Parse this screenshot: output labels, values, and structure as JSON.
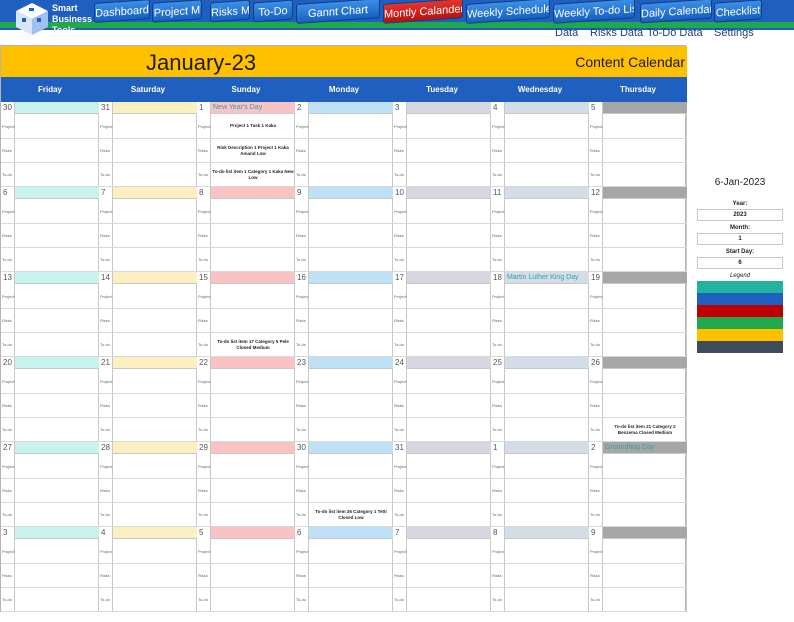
{
  "brand": {
    "line1": "Smart",
    "line2": "Business",
    "line3": "Tools"
  },
  "nav": {
    "tabs": [
      {
        "label": "Dashboard",
        "active": false
      },
      {
        "label": "Project M",
        "active": false
      },
      {
        "label": "Risks M.",
        "active": false
      },
      {
        "label": "To-Do",
        "active": false
      },
      {
        "label": "Gannt Chart",
        "active": false
      },
      {
        "label": "Montly Calander",
        "active": true
      },
      {
        "label": "Weekly Schedule",
        "active": false
      },
      {
        "label": "Weekly To-do List",
        "active": false
      },
      {
        "label": "Daily Calendar",
        "active": false
      },
      {
        "label": "Checklist",
        "active": false
      }
    ],
    "sublinks": [
      "Data",
      "Risks Data",
      "To-Do Data",
      "Settings"
    ]
  },
  "calendar": {
    "month_title": "January-23",
    "subtitle": "Content Calendar",
    "days": [
      "Friday",
      "Saturday",
      "Sunday",
      "Monday",
      "Tuesday",
      "Wednesday",
      "Thursday"
    ],
    "row_labels": [
      "Project",
      "Risks",
      "To-do"
    ],
    "day_colors": [
      "#c8f2ee",
      "#fcefc2",
      "#f9c3c3",
      "#bfe1f7",
      "#d6d6e0",
      "#d2dde8",
      "#a6a6a6"
    ],
    "weeks": [
      [
        {
          "date": "30",
          "holiday": "",
          "items": [
            "",
            "",
            ""
          ]
        },
        {
          "date": "31",
          "holiday": "",
          "items": [
            "",
            "",
            ""
          ]
        },
        {
          "date": "1",
          "holiday": "New Year's Day",
          "items": [
            "Project 1 Task 1 Kaka",
            "Risk Description 1 Project 1 Kaka Amand Low",
            "To-do list item 1 Category 1 Kaka New Low"
          ]
        },
        {
          "date": "2",
          "holiday": "",
          "items": [
            "",
            "",
            ""
          ]
        },
        {
          "date": "3",
          "holiday": "",
          "items": [
            "",
            "",
            ""
          ]
        },
        {
          "date": "4",
          "holiday": "",
          "items": [
            "",
            "",
            ""
          ]
        },
        {
          "date": "5",
          "holiday": "",
          "items": [
            "",
            "",
            ""
          ]
        }
      ],
      [
        {
          "date": "6",
          "holiday": "",
          "items": [
            "",
            "",
            ""
          ]
        },
        {
          "date": "7",
          "holiday": "",
          "items": [
            "",
            "",
            ""
          ]
        },
        {
          "date": "8",
          "holiday": "",
          "items": [
            "",
            "",
            ""
          ]
        },
        {
          "date": "9",
          "holiday": "",
          "items": [
            "",
            "",
            ""
          ]
        },
        {
          "date": "10",
          "holiday": "",
          "items": [
            "",
            "",
            ""
          ]
        },
        {
          "date": "11",
          "holiday": "",
          "items": [
            "",
            "",
            ""
          ]
        },
        {
          "date": "12",
          "holiday": "",
          "items": [
            "",
            "",
            ""
          ]
        }
      ],
      [
        {
          "date": "13",
          "holiday": "",
          "items": [
            "",
            "",
            ""
          ]
        },
        {
          "date": "14",
          "holiday": "",
          "items": [
            "",
            "",
            ""
          ]
        },
        {
          "date": "15",
          "holiday": "",
          "items": [
            "",
            "",
            "To-do list item 17 Category 5 Pele Closed Medium"
          ]
        },
        {
          "date": "16",
          "holiday": "",
          "items": [
            "",
            "",
            ""
          ]
        },
        {
          "date": "17",
          "holiday": "",
          "items": [
            "",
            "",
            ""
          ]
        },
        {
          "date": "18",
          "holiday": "Martin Luther King Day",
          "items": [
            "",
            "",
            ""
          ]
        },
        {
          "date": "19",
          "holiday": "",
          "items": [
            "",
            "",
            ""
          ]
        }
      ],
      [
        {
          "date": "20",
          "holiday": "",
          "items": [
            "",
            "",
            ""
          ]
        },
        {
          "date": "21",
          "holiday": "",
          "items": [
            "",
            "",
            ""
          ]
        },
        {
          "date": "22",
          "holiday": "",
          "items": [
            "",
            "",
            ""
          ]
        },
        {
          "date": "23",
          "holiday": "",
          "items": [
            "",
            "",
            ""
          ]
        },
        {
          "date": "24",
          "holiday": "",
          "items": [
            "",
            "",
            ""
          ]
        },
        {
          "date": "25",
          "holiday": "",
          "items": [
            "",
            "",
            ""
          ]
        },
        {
          "date": "26",
          "holiday": "",
          "items": [
            "",
            "",
            "To-do list item 21 Category 2 Benzema Closed Medium"
          ]
        }
      ],
      [
        {
          "date": "27",
          "holiday": "",
          "items": [
            "",
            "",
            ""
          ]
        },
        {
          "date": "28",
          "holiday": "",
          "items": [
            "",
            "",
            ""
          ]
        },
        {
          "date": "29",
          "holiday": "",
          "items": [
            "",
            "",
            ""
          ]
        },
        {
          "date": "30",
          "holiday": "",
          "items": [
            "",
            "",
            "To-do list item 26 Category 1 Tetti Closed Low"
          ]
        },
        {
          "date": "31",
          "holiday": "",
          "items": [
            "",
            "",
            ""
          ]
        },
        {
          "date": "1",
          "holiday": "",
          "items": [
            "",
            "",
            ""
          ]
        },
        {
          "date": "2",
          "holiday": "Groundhog Day",
          "items": [
            "",
            "",
            ""
          ]
        }
      ],
      [
        {
          "date": "3",
          "holiday": "",
          "items": [
            "",
            "",
            ""
          ]
        },
        {
          "date": "4",
          "holiday": "",
          "items": [
            "",
            "",
            ""
          ]
        },
        {
          "date": "5",
          "holiday": "",
          "items": [
            "",
            "",
            ""
          ]
        },
        {
          "date": "6",
          "holiday": "",
          "items": [
            "",
            "",
            ""
          ]
        },
        {
          "date": "7",
          "holiday": "",
          "items": [
            "",
            "",
            ""
          ]
        },
        {
          "date": "8",
          "holiday": "",
          "items": [
            "",
            "",
            ""
          ]
        },
        {
          "date": "9",
          "holiday": "",
          "items": [
            "",
            "",
            ""
          ]
        }
      ]
    ]
  },
  "side": {
    "current_date": "6-Jan-2023",
    "year_label": "Year:",
    "year_value": "2023",
    "month_label": "Month:",
    "month_value": "1",
    "startday_label": "Start Day:",
    "startday_value": "6",
    "legend_label": "Legend",
    "legend_colors": [
      "#21b2a0",
      "#1f5fbf",
      "#c00000",
      "#21a84a",
      "#ffc000",
      "#3d4b5c"
    ]
  }
}
